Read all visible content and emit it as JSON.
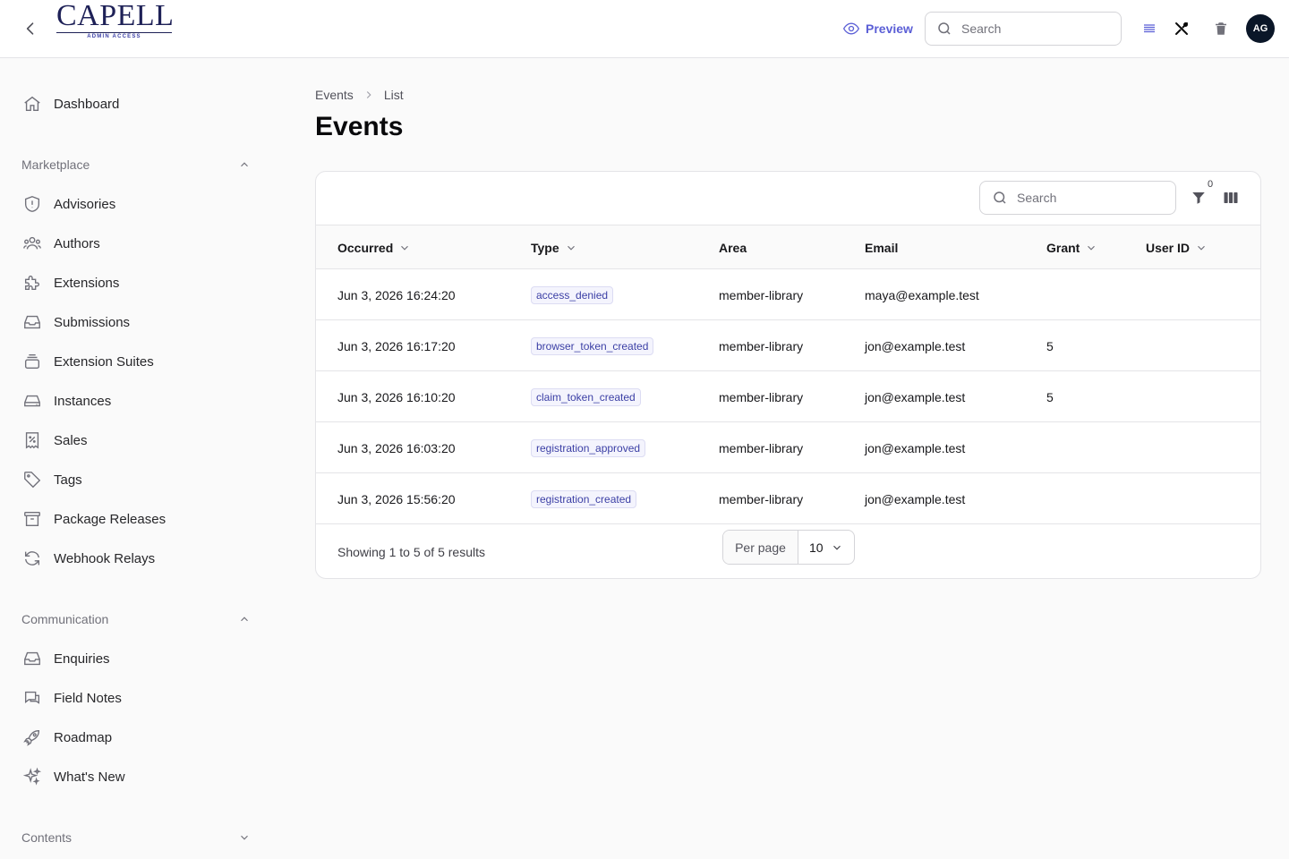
{
  "topbar": {
    "logo_word": "CAPELL",
    "logo_sub": "ADMIN ACCESS",
    "preview_label": "Preview",
    "search_placeholder": "Search",
    "avatar_initials": "AG"
  },
  "sidebar": {
    "dashboard": "Dashboard",
    "groups": [
      {
        "label": "Marketplace",
        "expanded": true,
        "items": [
          {
            "label": "Advisories",
            "icon": "shield-exclamation-icon"
          },
          {
            "label": "Authors",
            "icon": "user-group-icon"
          },
          {
            "label": "Extensions",
            "icon": "puzzle-piece-icon"
          },
          {
            "label": "Submissions",
            "icon": "inbox-icon"
          },
          {
            "label": "Extension Suites",
            "icon": "rectangle-stack-icon"
          },
          {
            "label": "Instances",
            "icon": "server-icon"
          },
          {
            "label": "Sales",
            "icon": "receipt-percent-icon"
          },
          {
            "label": "Tags",
            "icon": "tag-icon"
          },
          {
            "label": "Package Releases",
            "icon": "archive-box-icon"
          },
          {
            "label": "Webhook Relays",
            "icon": "arrow-path-icon"
          }
        ]
      },
      {
        "label": "Communication",
        "expanded": true,
        "items": [
          {
            "label": "Enquiries",
            "icon": "inbox-icon"
          },
          {
            "label": "Field Notes",
            "icon": "chat-bubbles-icon"
          },
          {
            "label": "Roadmap",
            "icon": "rocket-icon"
          },
          {
            "label": "What's New",
            "icon": "sparkles-icon"
          }
        ]
      },
      {
        "label": "Contents",
        "expanded": false,
        "items": []
      }
    ]
  },
  "breadcrumb": [
    "Events",
    "List"
  ],
  "page_title": "Events",
  "table": {
    "search_placeholder": "Search",
    "filter_count": "0",
    "columns": [
      {
        "label": "Occurred",
        "sortable": true
      },
      {
        "label": "Type",
        "sortable": true
      },
      {
        "label": "Area",
        "sortable": false
      },
      {
        "label": "Email",
        "sortable": false
      },
      {
        "label": "Grant",
        "sortable": true
      },
      {
        "label": "User ID",
        "sortable": true
      }
    ],
    "rows": [
      {
        "occurred": "Jun 3, 2026 16:24:20",
        "type": "access_denied",
        "area": "member-library",
        "email": "maya@example.test",
        "grant": "",
        "user_id": ""
      },
      {
        "occurred": "Jun 3, 2026 16:17:20",
        "type": "browser_token_created",
        "area": "member-library",
        "email": "jon@example.test",
        "grant": "5",
        "user_id": ""
      },
      {
        "occurred": "Jun 3, 2026 16:10:20",
        "type": "claim_token_created",
        "area": "member-library",
        "email": "jon@example.test",
        "grant": "5",
        "user_id": ""
      },
      {
        "occurred": "Jun 3, 2026 16:03:20",
        "type": "registration_approved",
        "area": "member-library",
        "email": "jon@example.test",
        "grant": "",
        "user_id": ""
      },
      {
        "occurred": "Jun 3, 2026 15:56:20",
        "type": "registration_created",
        "area": "member-library",
        "email": "jon@example.test",
        "grant": "",
        "user_id": ""
      }
    ],
    "results_text": "Showing 1 to 5 of 5 results",
    "per_page_label": "Per page",
    "per_page_value": "10"
  },
  "colors": {
    "accent": "#5b5fd6",
    "badge_text": "#3b3fa5",
    "avatar_bg": "#0a1628"
  }
}
